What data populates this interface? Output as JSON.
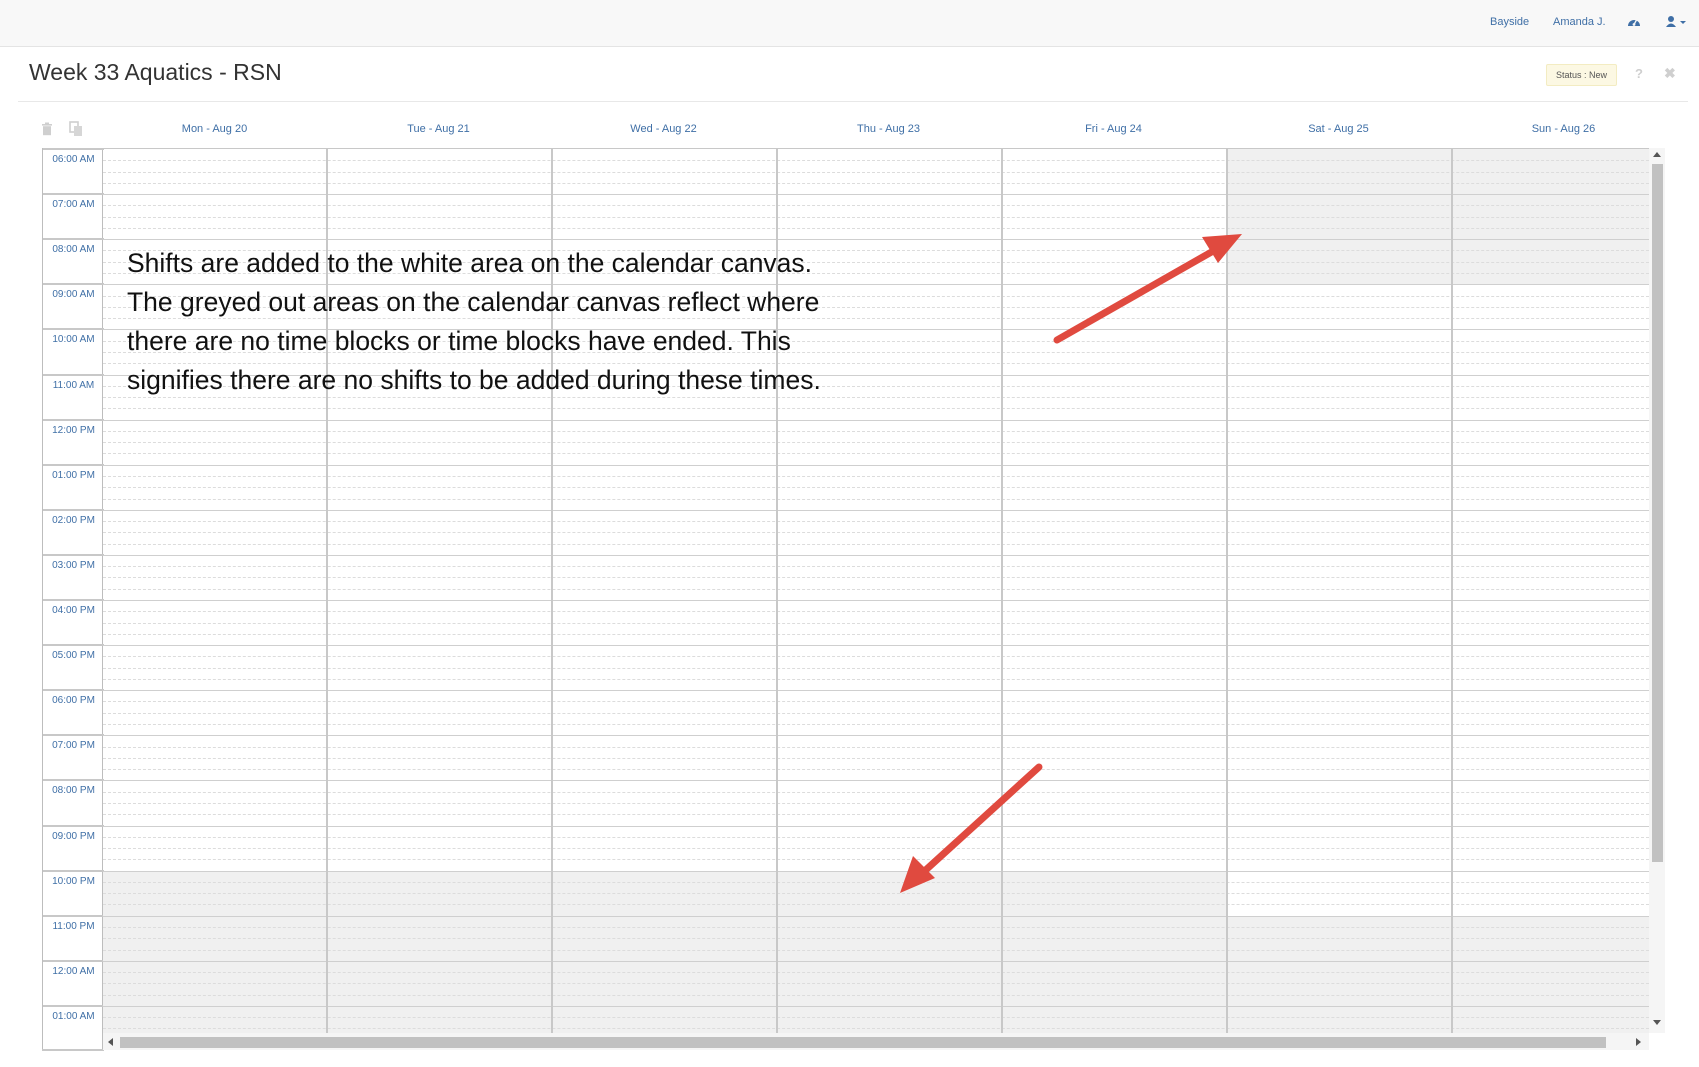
{
  "topbar": {
    "location": "Bayside",
    "user_name": "Amanda J.",
    "dashboard_icon": "dashboard-icon",
    "user_menu_icon": "user-icon"
  },
  "page": {
    "title": "Week 33 Aquatics - RSN",
    "status": "Status : New",
    "help_icon": "?",
    "close_icon": "✖"
  },
  "toolbar": {
    "delete_icon": "trash-icon",
    "copy_icon": "copy-icon"
  },
  "calendar": {
    "days": [
      "Mon - Aug 20",
      "Tue - Aug 21",
      "Wed - Aug 22",
      "Thu - Aug 23",
      "Fri - Aug 24",
      "Sat - Aug 25",
      "Sun - Aug 26"
    ],
    "times": [
      "06:00 AM",
      "07:00 AM",
      "08:00 AM",
      "09:00 AM",
      "10:00 AM",
      "11:00 AM",
      "12:00 PM",
      "01:00 PM",
      "02:00 PM",
      "03:00 PM",
      "04:00 PM",
      "05:00 PM",
      "06:00 PM",
      "07:00 PM",
      "08:00 PM",
      "09:00 PM",
      "10:00 PM",
      "11:00 PM",
      "12:00 AM",
      "01:00 AM"
    ],
    "unavailable_blocks": [
      {
        "day": "Sat - Aug 25",
        "from": "06:00 AM",
        "to": "09:00 AM"
      },
      {
        "day": "Sun - Aug 26",
        "from": "06:00 AM",
        "to": "09:00 AM"
      },
      {
        "day": "Mon - Aug 20",
        "from": "10:00 PM",
        "to": "end"
      },
      {
        "day": "Tue - Aug 21",
        "from": "10:00 PM",
        "to": "end"
      },
      {
        "day": "Wed - Aug 22",
        "from": "10:00 PM",
        "to": "end"
      },
      {
        "day": "Thu - Aug 23",
        "from": "10:00 PM",
        "to": "end"
      },
      {
        "day": "Fri - Aug 24",
        "from": "10:00 PM",
        "to": "end"
      },
      {
        "day": "Sat - Aug 25",
        "from": "11:00 PM",
        "to": "end"
      },
      {
        "day": "Sun - Aug 26",
        "from": "11:00 PM",
        "to": "end"
      }
    ],
    "grey_color": "#f0f0f0"
  },
  "annotation": {
    "lines": [
      "Shifts are added to the white area on the calendar canvas.",
      "The greyed out areas on the calendar canvas reflect where",
      "there are no time blocks or time blocks have ended.  This",
      "signifies there are no shifts to be added during these times."
    ],
    "arrow_color": "#e04a3f"
  }
}
